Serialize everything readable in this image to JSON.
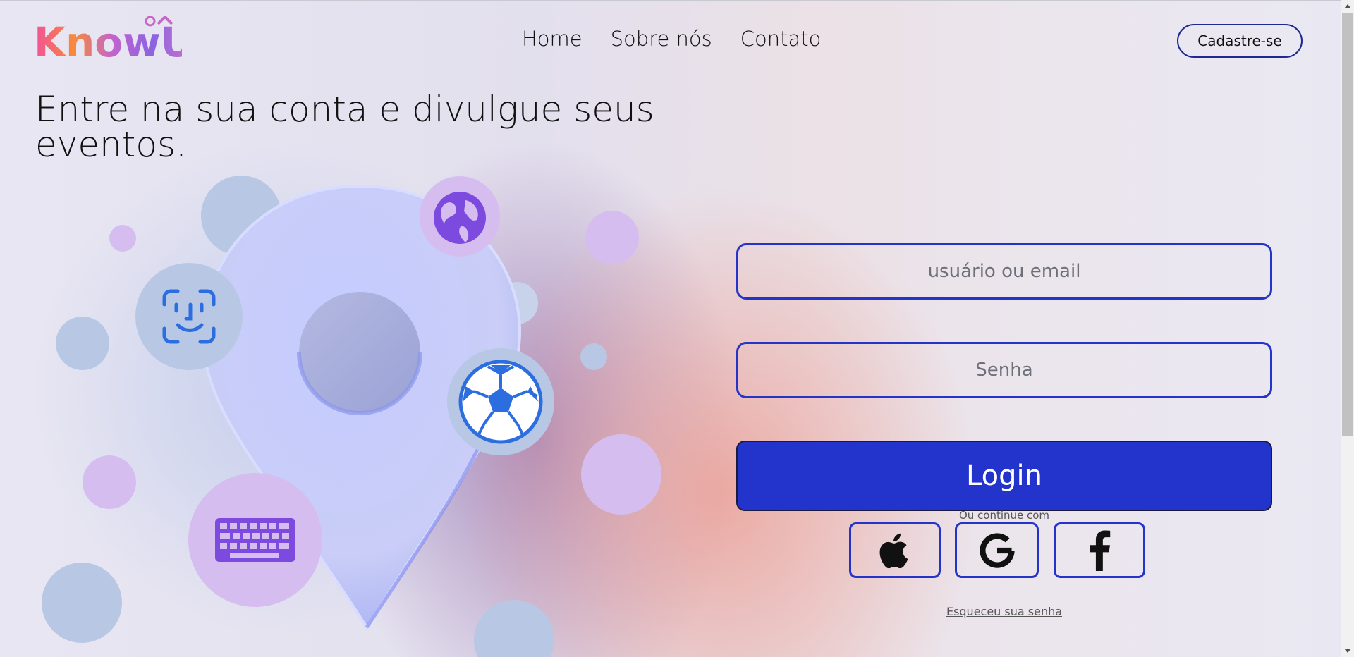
{
  "brand": {
    "logo_text": "KnowU"
  },
  "nav": {
    "items": [
      {
        "label": "Home"
      },
      {
        "label": "Sobre nós"
      },
      {
        "label": "Contato"
      }
    ]
  },
  "header": {
    "signup_label": "Cadastre-se"
  },
  "hero": {
    "title": "Entre na sua conta e divulgue seus eventos."
  },
  "login_form": {
    "user_placeholder": "usuário ou email",
    "password_placeholder": "Senha",
    "login_label": "Login",
    "or_continue": "Ou continue com",
    "social": [
      {
        "icon": "apple-icon"
      },
      {
        "icon": "google-icon"
      },
      {
        "icon": "facebook-icon"
      }
    ],
    "forgot_label": "Esqueceu sua senha"
  },
  "illustration": {
    "icons": [
      "globe-icon",
      "face-id-icon",
      "soccer-ball-icon",
      "keyboard-icon",
      "location-pin-icon"
    ]
  },
  "colors": {
    "accent": "#2334cc",
    "border": "#2434c8",
    "bubble_blue": "#b8c8e4",
    "bubble_purple": "#d6bdf0"
  }
}
